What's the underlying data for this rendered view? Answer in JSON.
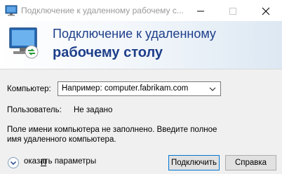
{
  "window": {
    "title": "Подключение к удаленному рабочему с..."
  },
  "header": {
    "line1": "Подключение к удаленному",
    "line2": "рабочему столу"
  },
  "form": {
    "computer_label": "Компьютер:",
    "computer_value": "Например: computer.fabrikam.com",
    "user_label": "Пользователь:",
    "user_value": "Не задано",
    "warning_line1": "Поле имени компьютера не заполнено. Введите полное",
    "warning_line2": "имя удаленного компьютера."
  },
  "footer": {
    "show_options_label": "оказать параметры",
    "show_options_accel": "П",
    "connect_label": "Подключить",
    "help_label": "Справка"
  },
  "colors": {
    "accent": "#1e3f8a",
    "focus_border": "#0078d7"
  }
}
